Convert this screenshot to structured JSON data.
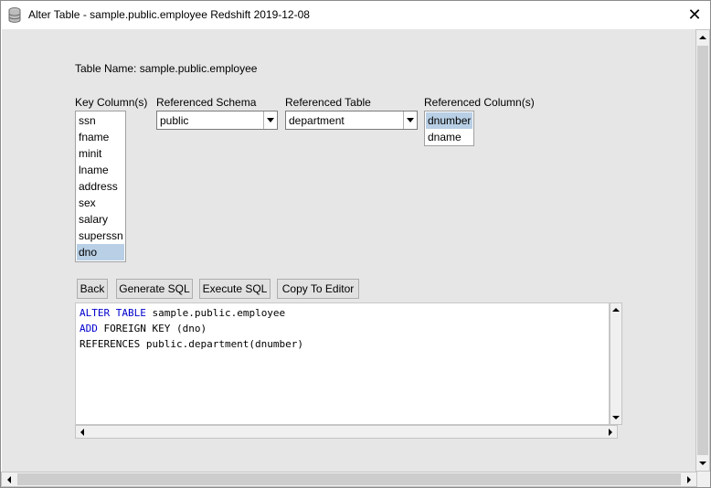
{
  "window": {
    "title": "Alter Table - sample.public.employee Redshift 2019-12-08",
    "close_glyph": "✕"
  },
  "table_name_label": "Table Name: sample.public.employee",
  "key_columns": {
    "label": "Key Column(s)",
    "items": [
      "ssn",
      "fname",
      "minit",
      "lname",
      "address",
      "sex",
      "salary",
      "superssn",
      "dno"
    ],
    "selected": "dno"
  },
  "referenced_schema": {
    "label": "Referenced Schema",
    "value": "public"
  },
  "referenced_table": {
    "label": "Referenced Table",
    "value": "department"
  },
  "referenced_columns": {
    "label": "Referenced Column(s)",
    "items": [
      "dnumber",
      "dname"
    ],
    "selected": "dnumber"
  },
  "buttons": {
    "back": "Back",
    "generate_sql": "Generate SQL",
    "execute_sql": "Execute SQL",
    "copy_to_editor": "Copy To Editor"
  },
  "sql": {
    "line1_kw": "ALTER TABLE",
    "line1_rest": " sample.public.employee",
    "line2_kw": "ADD",
    "line2_rest": " FOREIGN KEY (dno)",
    "line3": "REFERENCES public.department(dnumber)"
  },
  "colors": {
    "keyword": "#0000cc",
    "selection": "#b8cfe5",
    "panel": "#e6e6e6"
  },
  "icons": {
    "title": "database-icon",
    "close": "close-icon"
  }
}
